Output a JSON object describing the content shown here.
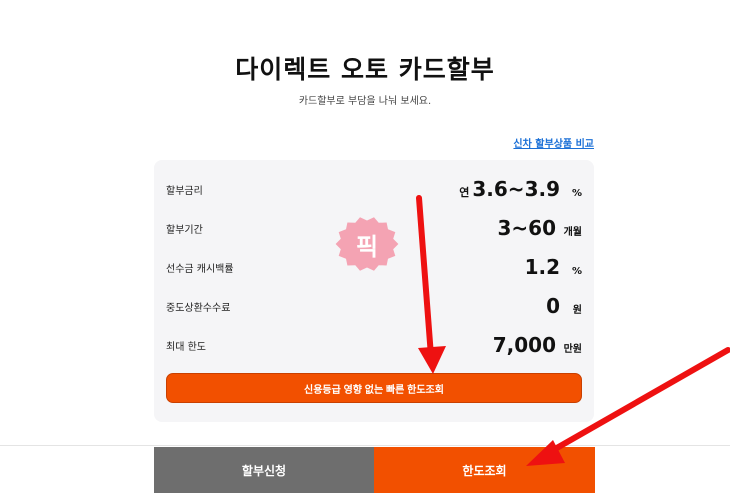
{
  "header": {
    "title": "다이렉트 오토 카드할부",
    "subtitle": "카드할부로 부담을 나눠 보세요."
  },
  "compare_link": "신차 할부상품 비교",
  "rows": [
    {
      "label": "할부금리",
      "prefix": "연",
      "value": "3.6~3.9",
      "unit": "%"
    },
    {
      "label": "할부기간",
      "value": "3~60",
      "unit": "개월"
    },
    {
      "label": "선수금 캐시백률",
      "value": "1.2",
      "unit": "%"
    },
    {
      "label": "중도상환수수료",
      "value": "0",
      "unit": "원"
    },
    {
      "label": "최대 한도",
      "value": "7,000",
      "unit": "만원"
    }
  ],
  "badge": {
    "text": "픽",
    "color": "#f4a3b3"
  },
  "credit_button": "신용등급 영향 없는 빠른 한도조회",
  "bottom": {
    "apply_label": "할부신청",
    "limit_label": "한도조회"
  },
  "colors": {
    "accent": "#f25000",
    "gray_button": "#6e6e6e",
    "arrow": "#ee1111",
    "link": "#1a6fd6"
  }
}
